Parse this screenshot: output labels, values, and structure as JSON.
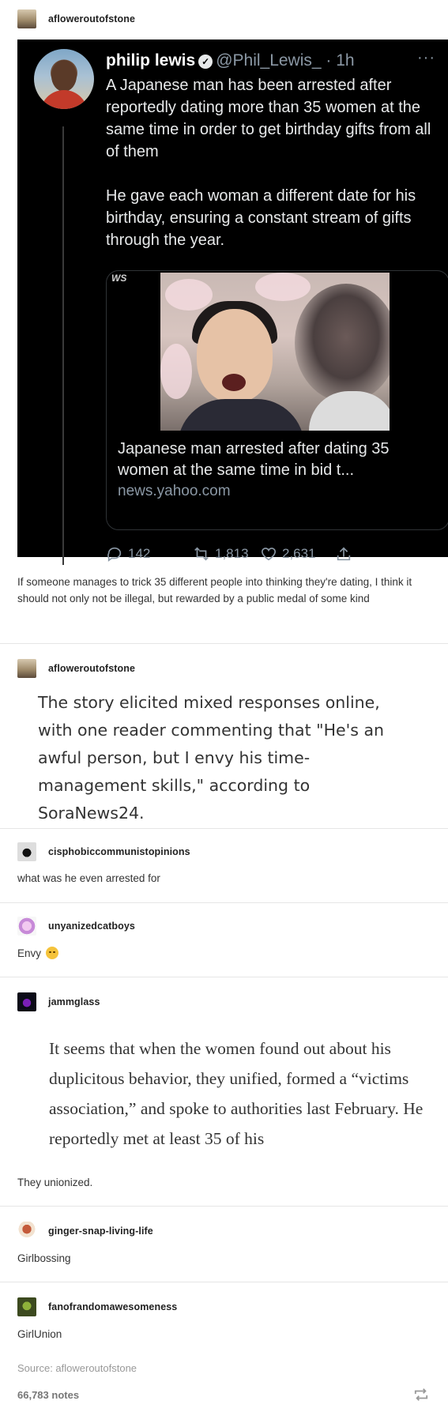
{
  "posts": [
    {
      "username": "afloweroutofstone",
      "tweet": {
        "name": "philip lewis",
        "handle": "@Phil_Lewis_",
        "time": "· 1h",
        "more": "···",
        "paragraph1": "A Japanese man has been arrested after reportedly dating more than 35 women at the same time in order  to get birthday gifts from all of them",
        "paragraph2": "He gave each woman a different date for his birthday, ensuring a constant stream of gifts through the year.",
        "card_label": "WS",
        "card_title": "Japanese man arrested after dating 35 women at the same time in bid t...",
        "card_domain": "news.yahoo.com",
        "replies": "142",
        "retweets": "1,813",
        "likes": "2,631"
      },
      "caption": "If someone manages to trick 35 different people into thinking they're dating, I think it should not only not be illegal, but rewarded by a public medal of some kind"
    },
    {
      "username": "afloweroutofstone",
      "quote": "The story elicited mixed responses online, with one reader commenting that \"He's an awful person, but I envy his time-management skills,\" according to SoraNews24."
    },
    {
      "username": "cisphobiccommunistopinions",
      "text": "what was he even arrested for"
    },
    {
      "username": "unyanizedcatboys",
      "text": "Envy"
    },
    {
      "username": "jammglass",
      "quote": "It seems that when the women found out about his duplicitous behavior, they unified, formed a “victims association,” and spoke to authorities last February. He reportedly met at least 35 of his",
      "text": "They unionized."
    },
    {
      "username": "ginger-snap-living-life",
      "text": "Girlbossing"
    },
    {
      "username": "fanofrandomawesomeness",
      "text": "GirlUnion"
    }
  ],
  "footer": {
    "source": "Source: afloweroutofstone",
    "notes": "66,783 notes"
  },
  "icons": {
    "reply": "reply-icon",
    "retweet": "retweet-icon",
    "like": "heart-icon",
    "share": "share-icon",
    "reblog": "reblog-icon"
  },
  "colors": {
    "tweet_background": "#000000",
    "tweet_text": "#e7e9ea",
    "tweet_secondary": "#8b98a5"
  }
}
